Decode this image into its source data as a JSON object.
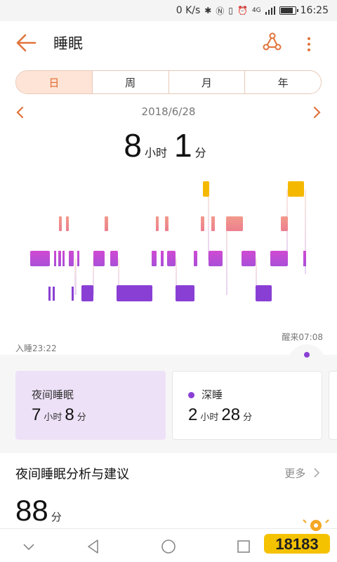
{
  "status_bar": {
    "speed": "0 K/s",
    "signal": "4G",
    "time": "16:25",
    "battery_level": 0.8
  },
  "app_bar": {
    "title": "睡眠",
    "back_icon": "arrow-left-icon",
    "share_icon": "share-icon",
    "more_icon": "more-vertical-icon"
  },
  "tabs": [
    {
      "label": "日",
      "active": true
    },
    {
      "label": "周",
      "active": false
    },
    {
      "label": "月",
      "active": false
    },
    {
      "label": "年",
      "active": false
    }
  ],
  "date": "2018/6/28",
  "total": {
    "hours": "8",
    "hours_unit": "小时",
    "minutes": "1",
    "minutes_unit": "分"
  },
  "chart": {
    "start_label": "入睡23:22",
    "end_label": "醒来07:08",
    "colors": {
      "awake": "#f5b800",
      "rem": "#f08a88",
      "light": "#c73fd3",
      "deep": "#8a3fd4"
    }
  },
  "cards": [
    {
      "title": "夜间睡眠",
      "hours": "7",
      "hours_unit": "小时",
      "minutes": "8",
      "minutes_unit": "分",
      "selected": true
    },
    {
      "title": "深睡",
      "hours": "2",
      "hours_unit": "小时",
      "minutes": "28",
      "minutes_unit": "分",
      "selected": false
    }
  ],
  "analysis": {
    "title": "夜间睡眠分析与建议",
    "more": "更多",
    "score": "88",
    "score_unit": "分"
  },
  "watermark": "18183"
}
